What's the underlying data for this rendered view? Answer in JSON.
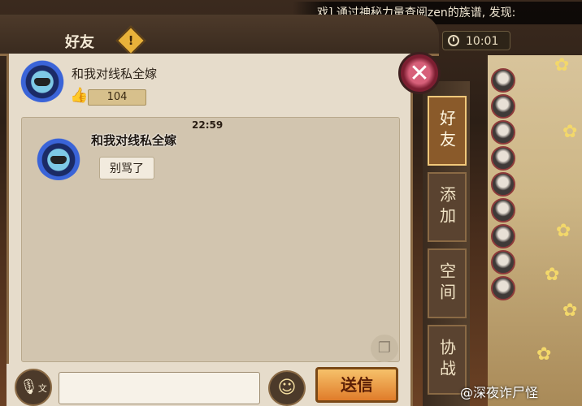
{
  "ticker": {
    "text": "戏] 通过神秘力量查阅zen的族谱, 发现:"
  },
  "clock": {
    "time": "10:01"
  },
  "header": {
    "title": "好友",
    "alert": "!"
  },
  "friend": {
    "name": "和我对线私全嫁",
    "likes": "104"
  },
  "chat": {
    "time": "22:59",
    "sender": "和我对线私全嫁",
    "message": "别骂了"
  },
  "input": {
    "value": "",
    "send_label": "送信",
    "voice_label": "文"
  },
  "side_tabs": [
    {
      "label": "好友",
      "active": true
    },
    {
      "label": "添加",
      "active": false
    },
    {
      "label": "空间",
      "active": false
    },
    {
      "label": "协战",
      "active": false
    }
  ],
  "watermark": {
    "text": "@深夜诈尸怪"
  },
  "colors": {
    "send_button": "#e07c2a",
    "panel": "#e6dccb",
    "chat_area": "#d2c5af",
    "active_tab": "#8a5a2a"
  },
  "icons": {
    "close": "close-icon",
    "like": "thumbs-up-icon",
    "voice": "microphone-icon",
    "emoji": "emoji-icon",
    "copy": "copy-icon",
    "clock": "clock-icon"
  }
}
